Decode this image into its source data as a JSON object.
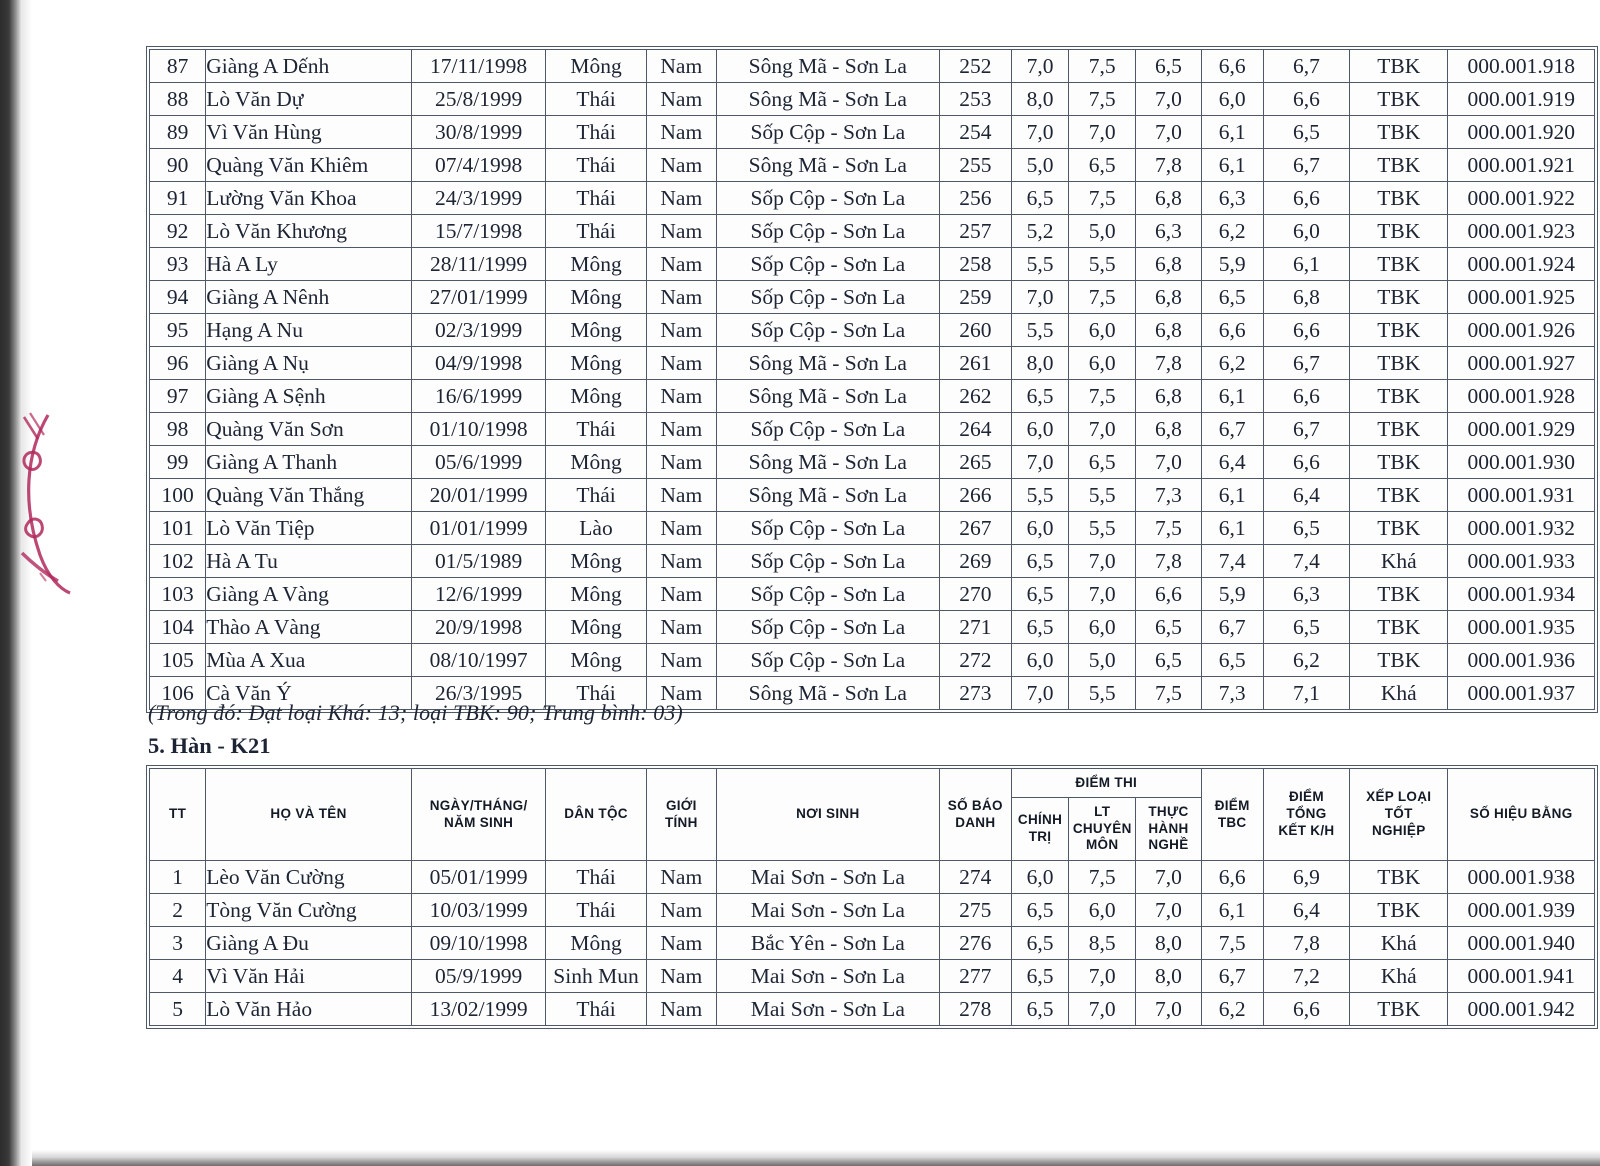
{
  "document": {
    "summary_note": "(Trong đó: Đạt loại Khá: 13; loại TBK: 90; Trung bình: 03)",
    "section_heading": "5. Hàn - K21"
  },
  "table_continuation": {
    "rows": [
      {
        "tt": "87",
        "name": "Giàng A Dếnh",
        "dob": "17/11/1998",
        "ethnic": "Mông",
        "gender": "Nam",
        "birthplace": "Sông Mã  - Sơn La",
        "sbd": "252",
        "s1": "7,0",
        "s2": "7,5",
        "s3": "6,5",
        "tbc": "6,6",
        "total": "6,7",
        "rank": "TBK",
        "serial": "000.001.918"
      },
      {
        "tt": "88",
        "name": "Lò Văn Dự",
        "dob": "25/8/1999",
        "ethnic": "Thái",
        "gender": "Nam",
        "birthplace": "Sông Mã  - Sơn La",
        "sbd": "253",
        "s1": "8,0",
        "s2": "7,5",
        "s3": "7,0",
        "tbc": "6,0",
        "total": "6,6",
        "rank": "TBK",
        "serial": "000.001.919"
      },
      {
        "tt": "89",
        "name": "Vì Văn Hùng",
        "dob": "30/8/1999",
        "ethnic": "Thái",
        "gender": "Nam",
        "birthplace": "Sốp Cộp - Sơn La",
        "sbd": "254",
        "s1": "7,0",
        "s2": "7,0",
        "s3": "7,0",
        "tbc": "6,1",
        "total": "6,5",
        "rank": "TBK",
        "serial": "000.001.920"
      },
      {
        "tt": "90",
        "name": "Quàng Văn Khiêm",
        "dob": "07/4/1998",
        "ethnic": "Thái",
        "gender": "Nam",
        "birthplace": "Sông Mã  - Sơn La",
        "sbd": "255",
        "s1": "5,0",
        "s2": "6,5",
        "s3": "7,8",
        "tbc": "6,1",
        "total": "6,7",
        "rank": "TBK",
        "serial": "000.001.921"
      },
      {
        "tt": "91",
        "name": "Lường Văn Khoa",
        "dob": "24/3/1999",
        "ethnic": "Thái",
        "gender": "Nam",
        "birthplace": "Sốp Cộp - Sơn La",
        "sbd": "256",
        "s1": "6,5",
        "s2": "7,5",
        "s3": "6,8",
        "tbc": "6,3",
        "total": "6,6",
        "rank": "TBK",
        "serial": "000.001.922"
      },
      {
        "tt": "92",
        "name": "Lò Văn Khương",
        "dob": "15/7/1998",
        "ethnic": "Thái",
        "gender": "Nam",
        "birthplace": "Sốp Cộp - Sơn La",
        "sbd": "257",
        "s1": "5,2",
        "s2": "5,0",
        "s3": "6,3",
        "tbc": "6,2",
        "total": "6,0",
        "rank": "TBK",
        "serial": "000.001.923"
      },
      {
        "tt": "93",
        "name": "Hà A Ly",
        "dob": "28/11/1999",
        "ethnic": "Mông",
        "gender": "Nam",
        "birthplace": "Sốp Cộp - Sơn La",
        "sbd": "258",
        "s1": "5,5",
        "s2": "5,5",
        "s3": "6,8",
        "tbc": "5,9",
        "total": "6,1",
        "rank": "TBK",
        "serial": "000.001.924"
      },
      {
        "tt": "94",
        "name": "Giàng A Nênh",
        "dob": "27/01/1999",
        "ethnic": "Mông",
        "gender": "Nam",
        "birthplace": "Sốp Cộp - Sơn La",
        "sbd": "259",
        "s1": "7,0",
        "s2": "7,5",
        "s3": "6,8",
        "tbc": "6,5",
        "total": "6,8",
        "rank": "TBK",
        "serial": "000.001.925"
      },
      {
        "tt": "95",
        "name": "Hạng A Nu",
        "dob": "02/3/1999",
        "ethnic": "Mông",
        "gender": "Nam",
        "birthplace": "Sốp Cộp - Sơn La",
        "sbd": "260",
        "s1": "5,5",
        "s2": "6,0",
        "s3": "6,8",
        "tbc": "6,6",
        "total": "6,6",
        "rank": "TBK",
        "serial": "000.001.926"
      },
      {
        "tt": "96",
        "name": "Giàng A Nụ",
        "dob": "04/9/1998",
        "ethnic": "Mông",
        "gender": "Nam",
        "birthplace": "Sông Mã  - Sơn La",
        "sbd": "261",
        "s1": "8,0",
        "s2": "6,0",
        "s3": "7,8",
        "tbc": "6,2",
        "total": "6,7",
        "rank": "TBK",
        "serial": "000.001.927"
      },
      {
        "tt": "97",
        "name": "Giàng A Sệnh",
        "dob": "16/6/1999",
        "ethnic": "Mông",
        "gender": "Nam",
        "birthplace": "Sông Mã  - Sơn La",
        "sbd": "262",
        "s1": "6,5",
        "s2": "7,5",
        "s3": "6,8",
        "tbc": "6,1",
        "total": "6,6",
        "rank": "TBK",
        "serial": "000.001.928"
      },
      {
        "tt": "98",
        "name": "Quàng Văn Sơn",
        "dob": "01/10/1998",
        "ethnic": "Thái",
        "gender": "Nam",
        "birthplace": "Sốp Cộp - Sơn La",
        "sbd": "264",
        "s1": "6,0",
        "s2": "7,0",
        "s3": "6,8",
        "tbc": "6,7",
        "total": "6,7",
        "rank": "TBK",
        "serial": "000.001.929"
      },
      {
        "tt": "99",
        "name": "Giàng A Thanh",
        "dob": "05/6/1999",
        "ethnic": "Mông",
        "gender": "Nam",
        "birthplace": "Sông Mã  - Sơn La",
        "sbd": "265",
        "s1": "7,0",
        "s2": "6,5",
        "s3": "7,0",
        "tbc": "6,4",
        "total": "6,6",
        "rank": "TBK",
        "serial": "000.001.930"
      },
      {
        "tt": "100",
        "name": "Quàng Văn Thắng",
        "dob": "20/01/1999",
        "ethnic": "Thái",
        "gender": "Nam",
        "birthplace": "Sông Mã  - Sơn La",
        "sbd": "266",
        "s1": "5,5",
        "s2": "5,5",
        "s3": "7,3",
        "tbc": "6,1",
        "total": "6,4",
        "rank": "TBK",
        "serial": "000.001.931"
      },
      {
        "tt": "101",
        "name": "Lò Văn Tiệp",
        "dob": "01/01/1999",
        "ethnic": "Lào",
        "gender": "Nam",
        "birthplace": "Sốp Cộp - Sơn La",
        "sbd": "267",
        "s1": "6,0",
        "s2": "5,5",
        "s3": "7,5",
        "tbc": "6,1",
        "total": "6,5",
        "rank": "TBK",
        "serial": "000.001.932"
      },
      {
        "tt": "102",
        "name": "Hà A Tu",
        "dob": "01/5/1989",
        "ethnic": "Mông",
        "gender": "Nam",
        "birthplace": "Sốp Cộp - Sơn La",
        "sbd": "269",
        "s1": "6,5",
        "s2": "7,0",
        "s3": "7,8",
        "tbc": "7,4",
        "total": "7,4",
        "rank": "Khá",
        "serial": "000.001.933"
      },
      {
        "tt": "103",
        "name": "Giàng A Vàng",
        "dob": "12/6/1999",
        "ethnic": "Mông",
        "gender": "Nam",
        "birthplace": "Sốp Cộp - Sơn La",
        "sbd": "270",
        "s1": "6,5",
        "s2": "7,0",
        "s3": "6,6",
        "tbc": "5,9",
        "total": "6,3",
        "rank": "TBK",
        "serial": "000.001.934"
      },
      {
        "tt": "104",
        "name": "Thào A Vàng",
        "dob": "20/9/1998",
        "ethnic": "Mông",
        "gender": "Nam",
        "birthplace": "Sốp Cộp - Sơn La",
        "sbd": "271",
        "s1": "6,5",
        "s2": "6,0",
        "s3": "6,5",
        "tbc": "6,7",
        "total": "6,5",
        "rank": "TBK",
        "serial": "000.001.935"
      },
      {
        "tt": "105",
        "name": "Mùa A Xua",
        "dob": "08/10/1997",
        "ethnic": "Mông",
        "gender": "Nam",
        "birthplace": "Sốp Cộp - Sơn La",
        "sbd": "272",
        "s1": "6,0",
        "s2": "5,0",
        "s3": "6,5",
        "tbc": "6,5",
        "total": "6,2",
        "rank": "TBK",
        "serial": "000.001.936"
      },
      {
        "tt": "106",
        "name": "Cà Văn Ý",
        "dob": "26/3/1995",
        "ethnic": "Thái",
        "gender": "Nam",
        "birthplace": "Sông Mã  - Sơn La",
        "sbd": "273",
        "s1": "7,0",
        "s2": "5,5",
        "s3": "7,5",
        "tbc": "7,3",
        "total": "7,1",
        "rank": "Khá",
        "serial": "000.001.937"
      }
    ]
  },
  "table_han": {
    "headers": {
      "tt": "TT",
      "name": "HỌ VÀ TÊN",
      "dob_line1": "NGÀY/THÁNG/",
      "dob_line2": "NĂM SINH",
      "ethnic": "DÂN TỘC",
      "gender_line1": "GIỚI",
      "gender_line2": "TÍNH",
      "birthplace": "NƠI SINH",
      "sbd_line1": "SỐ BÁO",
      "sbd_line2": "DANH",
      "exam_group": "ĐIỂM THI",
      "s1_line1": "CHÍNH",
      "s1_line2": "TRỊ",
      "s2_line1": "LT",
      "s2_line2": "CHUYÊN",
      "s2_line3": "MÔN",
      "s3_line1": "THỰC",
      "s3_line2": "HÀNH",
      "s3_line3": "NGHỀ",
      "tbc_line1": "ĐIỂM",
      "tbc_line2": "TBC",
      "total_line1": "ĐIỂM",
      "total_line2": "TỔNG",
      "total_line3": "KẾT K/H",
      "rank_line1": "XẾP LOẠI",
      "rank_line2": "TỐT",
      "rank_line3": "NGHIỆP",
      "serial": "SỐ HIỆU BẰNG"
    },
    "rows": [
      {
        "tt": "1",
        "name": "Lèo Văn Cường",
        "dob": "05/01/1999",
        "ethnic": "Thái",
        "gender": "Nam",
        "birthplace": "Mai Sơn - Sơn La",
        "sbd": "274",
        "s1": "6,0",
        "s2": "7,5",
        "s3": "7,0",
        "tbc": "6,6",
        "total": "6,9",
        "rank": "TBK",
        "serial": "000.001.938"
      },
      {
        "tt": "2",
        "name": "Tòng Văn Cường",
        "dob": "10/03/1999",
        "ethnic": "Thái",
        "gender": "Nam",
        "birthplace": "Mai Sơn - Sơn La",
        "sbd": "275",
        "s1": "6,5",
        "s2": "6,0",
        "s3": "7,0",
        "tbc": "6,1",
        "total": "6,4",
        "rank": "TBK",
        "serial": "000.001.939"
      },
      {
        "tt": "3",
        "name": "Giàng A Đu",
        "dob": "09/10/1998",
        "ethnic": "Mông",
        "gender": "Nam",
        "birthplace": "Bắc Yên - Sơn La",
        "sbd": "276",
        "s1": "6,5",
        "s2": "8,5",
        "s3": "8,0",
        "tbc": "7,5",
        "total": "7,8",
        "rank": "Khá",
        "serial": "000.001.940"
      },
      {
        "tt": "4",
        "name": "Vì Văn Hải",
        "dob": "05/9/1999",
        "ethnic": "Sinh Mun",
        "gender": "Nam",
        "birthplace": "Mai Sơn - Sơn La",
        "sbd": "277",
        "s1": "6,5",
        "s2": "7,0",
        "s3": "8,0",
        "tbc": "6,7",
        "total": "7,2",
        "rank": "Khá",
        "serial": "000.001.941"
      },
      {
        "tt": "5",
        "name": "Lò Văn Hảo",
        "dob": "13/02/1999",
        "ethnic": "Thái",
        "gender": "Nam",
        "birthplace": "Mai Sơn - Sơn La",
        "sbd": "278",
        "s1": "6,5",
        "s2": "7,0",
        "s3": "7,0",
        "tbc": "6,2",
        "total": "6,6",
        "rank": "TBK",
        "serial": "000.001.942"
      }
    ]
  },
  "annotations": {
    "stamp_color": "#b0295c"
  }
}
